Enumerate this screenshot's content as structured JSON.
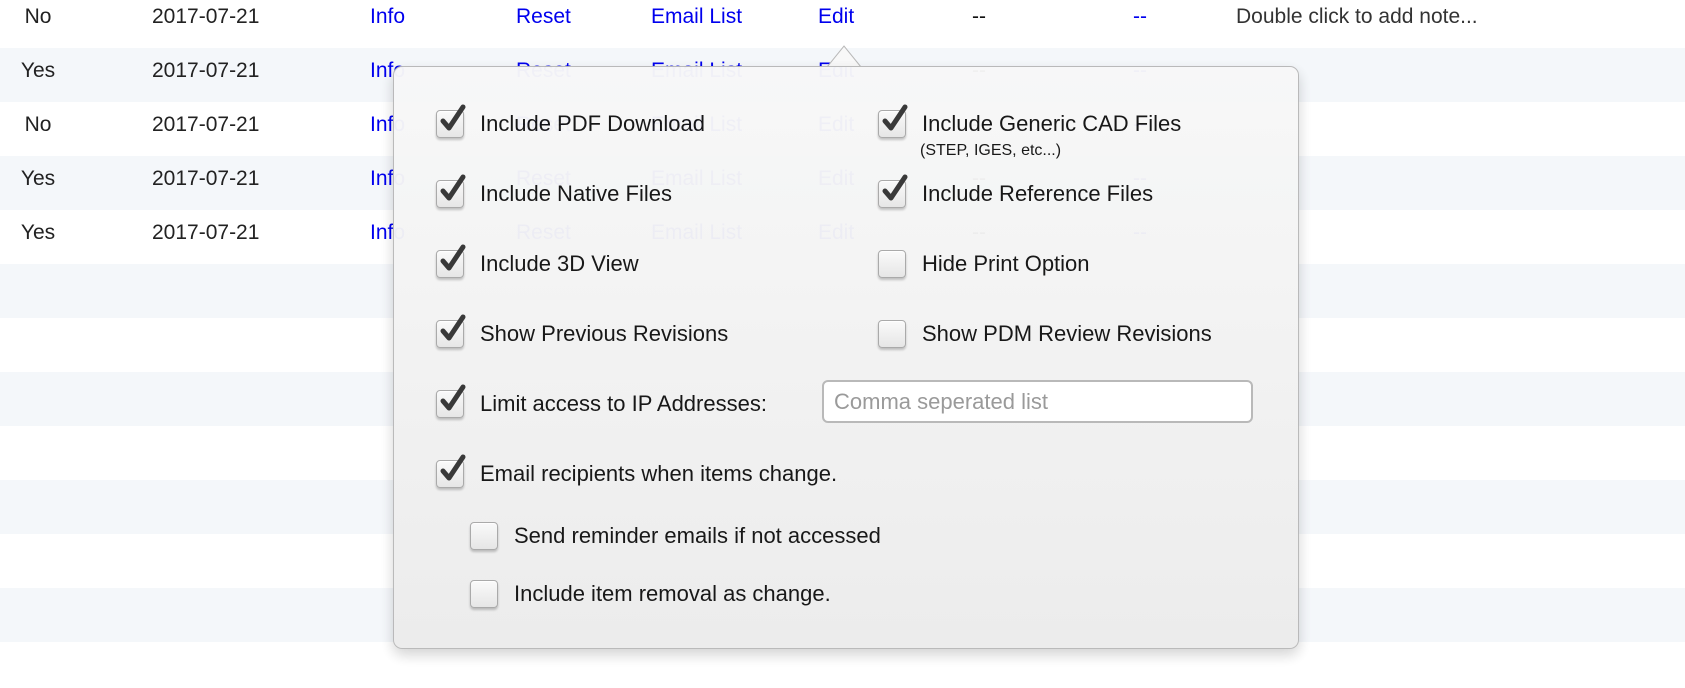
{
  "table": {
    "rows": [
      {
        "flag": "No",
        "date": "2017-07-21",
        "info": "Info",
        "reset": "Reset",
        "email_list": "Email List",
        "edit": "Edit",
        "dash1": "--",
        "dash2": "--",
        "note": "Double click to add note..."
      },
      {
        "flag": "Yes",
        "date": "2017-07-21",
        "info": "Info",
        "reset": "Reset",
        "email_list": "Email List",
        "edit": "Edit",
        "dash1": "--",
        "dash2": "--",
        "note": ""
      },
      {
        "flag": "No",
        "date": "2017-07-21",
        "info": "Info",
        "reset": "Reset",
        "email_list": "Email List",
        "edit": "Edit",
        "dash1": "--",
        "dash2": "--",
        "note": ""
      },
      {
        "flag": "Yes",
        "date": "2017-07-21",
        "info": "Info",
        "reset": "Reset",
        "email_list": "Email List",
        "edit": "Edit",
        "dash1": "--",
        "dash2": "--",
        "note": ""
      },
      {
        "flag": "Yes",
        "date": "2017-07-21",
        "info": "Info",
        "reset": "Reset",
        "email_list": "Email List",
        "edit": "Edit",
        "dash1": "--",
        "dash2": "--",
        "note": ""
      }
    ],
    "link_color": "#0000ee",
    "alt_row_color": "#f4f7fa"
  },
  "popover": {
    "options": [
      {
        "id": "include-pdf-download",
        "label": "Include PDF Download",
        "checked": true
      },
      {
        "id": "include-generic-cad-files",
        "label": "Include Generic CAD Files",
        "sublabel": "(STEP, IGES, etc...)",
        "checked": true
      },
      {
        "id": "include-native-files",
        "label": "Include Native Files",
        "checked": true
      },
      {
        "id": "include-reference-files",
        "label": "Include Reference Files",
        "checked": true
      },
      {
        "id": "include-3d-view",
        "label": "Include 3D View",
        "checked": true
      },
      {
        "id": "hide-print-option",
        "label": "Hide Print Option",
        "checked": false
      },
      {
        "id": "show-previous-revisions",
        "label": "Show Previous Revisions",
        "checked": true
      },
      {
        "id": "show-pdm-review-revisions",
        "label": "Show PDM Review Revisions",
        "checked": false
      },
      {
        "id": "limit-ip-addresses",
        "label": "Limit access to IP Addresses:",
        "checked": true
      },
      {
        "id": "email-recipients-on-change",
        "label": "Email recipients when items change.",
        "checked": true
      },
      {
        "id": "send-reminder-emails",
        "label": "Send reminder emails if not accessed",
        "checked": false
      },
      {
        "id": "include-item-removal",
        "label": "Include item removal as change.",
        "checked": false
      }
    ],
    "ip_input": {
      "value": "",
      "placeholder": "Comma seperated list"
    }
  }
}
